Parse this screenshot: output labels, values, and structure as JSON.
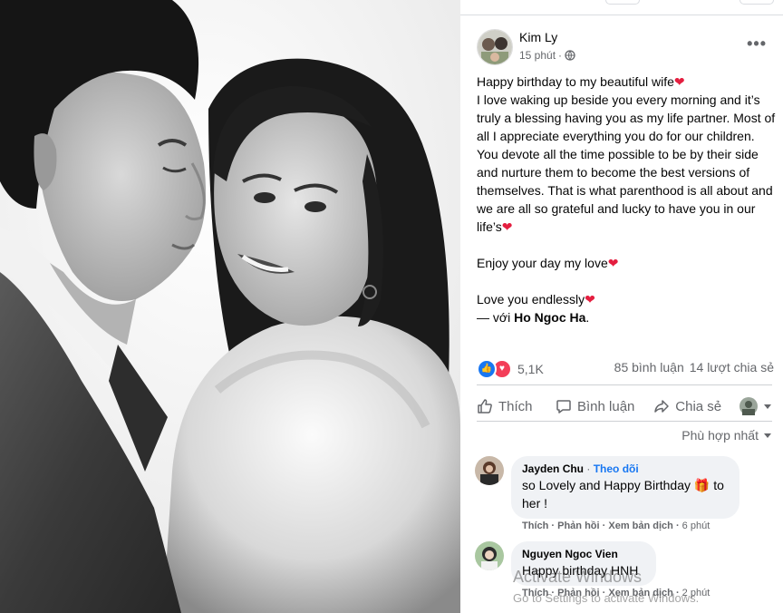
{
  "post": {
    "author": "Kim Ly",
    "time": "15 phút",
    "lines": [
      "Happy birthday to my beautiful wife",
      "I love waking up beside you every morning and it’s truly a blessing having you as my life partner. Most of all I appreciate everything you do for our children. You devote all the time possible to be by their side and nurture them to become the best versions of themselves. That is what parenthood is all about and we are all so grateful and lucky to have you in our life’s"
    ],
    "line2": "Enjoy your day my love",
    "line3": "Love you endlessly",
    "with_prefix": "— với ",
    "with_name": "Ho Ngoc Ha",
    "with_suffix": ".",
    "heart": "❤"
  },
  "stats": {
    "reactions": "5,1K",
    "comments": "85 bình luận",
    "shares": "14 lượt chia sẻ"
  },
  "actions": {
    "like": "Thích",
    "comment": "Bình luận",
    "share": "Chia sẻ"
  },
  "sort_label": "Phù hợp nhất",
  "comments": [
    {
      "name": "Jayden Chu",
      "follow": "Theo dõi",
      "text_a": "so Lovely and Happy Birthday ",
      "gift": "🎁",
      "text_b": " to her !",
      "like": "Thích",
      "reply": "Phản hồi",
      "translate": "Xem bản dịch",
      "time": "6 phút"
    },
    {
      "name": "Nguyen Ngoc Vien",
      "text": "Happy birthday HNH",
      "like": "Thích",
      "reply": "Phản hồi",
      "translate": "Xem bản dịch",
      "time": "2 phút"
    }
  ],
  "watermark": {
    "title": "Activate Windows",
    "sub": "Go to Settings to activate Windows."
  },
  "colors": {
    "link": "#1877f2",
    "heart": "#e41e3f",
    "secondary_text": "#65676b",
    "bubble": "#f0f2f5"
  }
}
